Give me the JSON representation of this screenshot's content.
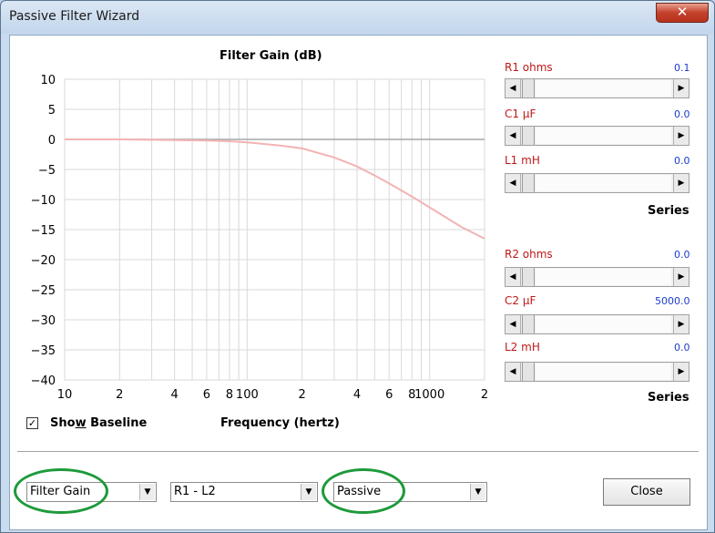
{
  "window": {
    "title": "Passive Filter Wizard",
    "close_glyph": "✕"
  },
  "chart_data": {
    "type": "line",
    "title": "Filter Gain (dB)",
    "xlabel": "Frequency (hertz)",
    "ylabel": "",
    "x_scale": "log",
    "xlim": [
      10,
      2000
    ],
    "ylim": [
      -40,
      10
    ],
    "y_ticks": [
      "10",
      "5",
      "0",
      "−5",
      "−10",
      "−15",
      "−20",
      "−25",
      "−30",
      "−35",
      "−40"
    ],
    "y_tick_values": [
      10,
      5,
      0,
      -5,
      -10,
      -15,
      -20,
      -25,
      -30,
      -35,
      -40
    ],
    "x_ticks": [
      {
        "value": 10,
        "label": "10"
      },
      {
        "value": 20,
        "label": "2"
      },
      {
        "value": 40,
        "label": "4"
      },
      {
        "value": 60,
        "label": "6"
      },
      {
        "value": 80,
        "label": "8"
      },
      {
        "value": 100,
        "label": "100"
      },
      {
        "value": 200,
        "label": "2"
      },
      {
        "value": 400,
        "label": "4"
      },
      {
        "value": 600,
        "label": "6"
      },
      {
        "value": 800,
        "label": "8"
      },
      {
        "value": 1000,
        "label": "1000"
      },
      {
        "value": 2000,
        "label": "2"
      }
    ],
    "grid": true,
    "series": [
      {
        "color": "#f3b3b3",
        "x": [
          10,
          20,
          40,
          60,
          80,
          100,
          150,
          200,
          300,
          400,
          500,
          600,
          800,
          1000,
          1500,
          2000
        ],
        "y": [
          0,
          0,
          -0.1,
          -0.2,
          -0.3,
          -0.5,
          -1.0,
          -1.5,
          -3.0,
          -4.5,
          -6.0,
          -7.3,
          -9.5,
          -11.3,
          -14.6,
          -16.5
        ]
      }
    ]
  },
  "params_series1": {
    "r1": {
      "label": "R1  ohms",
      "value": "0.1"
    },
    "c1": {
      "label": "C1  µF",
      "value": "0.0"
    },
    "l1": {
      "label": "L1  mH",
      "value": "0.0"
    },
    "mode": "Series"
  },
  "params_series2": {
    "r2": {
      "label": "R2  ohms",
      "value": "0.0"
    },
    "c2": {
      "label": "C2  µF",
      "value": "5000.0"
    },
    "l2": {
      "label": "L2  mH",
      "value": "0.0"
    },
    "mode": "Series"
  },
  "slider_arrows": {
    "left": "◀",
    "right": "▶"
  },
  "baseline": {
    "checked": true,
    "check_glyph": "✓",
    "label_pre": "Sho",
    "label_key": "w",
    "label_post": " Baseline"
  },
  "combos": {
    "plot_type": "Filter Gain",
    "topology": "R1 - L2",
    "filter_kind": "Passive",
    "arrow": "▼"
  },
  "close_button": "Close",
  "colors": {
    "accent_green": "#1d9a3a",
    "curve": "#f3b3b3",
    "param_label": "#c01818",
    "param_value": "#1a3ccc"
  }
}
